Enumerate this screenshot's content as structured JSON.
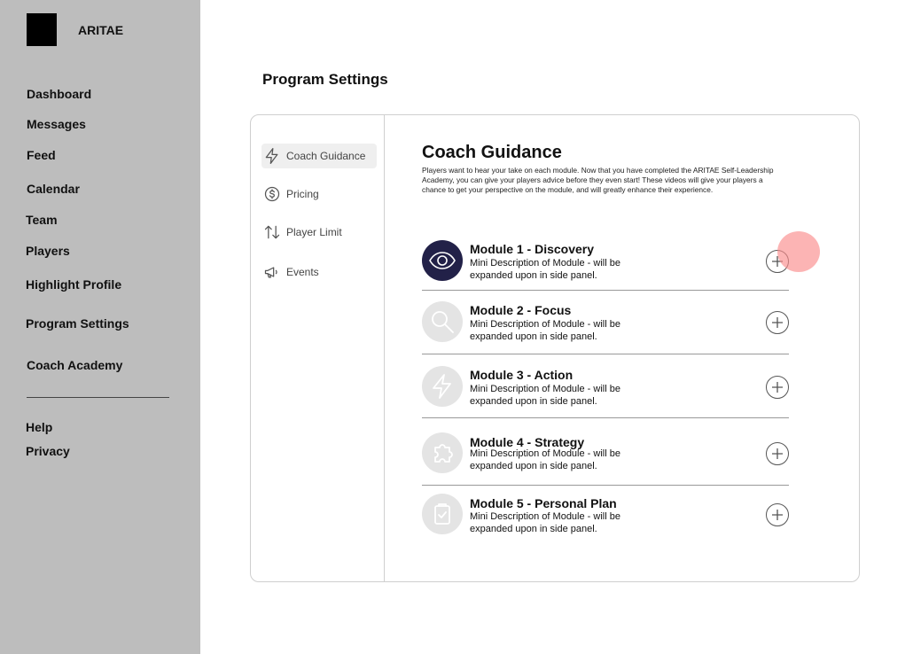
{
  "brand": {
    "name": "ARITAE"
  },
  "sidebar": {
    "items": [
      {
        "id": "dashboard",
        "label": "Dashboard"
      },
      {
        "id": "messages",
        "label": "Messages"
      },
      {
        "id": "feed",
        "label": "Feed"
      },
      {
        "id": "calendar",
        "label": "Calendar"
      },
      {
        "id": "team",
        "label": "Team"
      },
      {
        "id": "players",
        "label": "Players"
      },
      {
        "id": "highlight-profile",
        "label": "Highlight Profile"
      },
      {
        "id": "program-settings",
        "label": "Program Settings"
      },
      {
        "id": "coach-academy",
        "label": "Coach Academy"
      }
    ],
    "footer_items": [
      {
        "id": "help",
        "label": "Help"
      },
      {
        "id": "privacy",
        "label": "Privacy"
      }
    ]
  },
  "page": {
    "title": "Program Settings"
  },
  "settings_tabs": [
    {
      "id": "coach-guidance",
      "label": "Coach Guidance",
      "icon": "lightning-icon",
      "active": true
    },
    {
      "id": "pricing",
      "label": "Pricing",
      "icon": "dollar-icon",
      "active": false
    },
    {
      "id": "player-limit",
      "label": "Player Limit",
      "icon": "sort-arrows-icon",
      "active": false
    },
    {
      "id": "events",
      "label": "Events",
      "icon": "megaphone-icon",
      "active": false
    }
  ],
  "coach_guidance": {
    "title": "Coach Guidance",
    "description": "Players want to hear your take on each module. Now that you have completed the ARITAE Self-Leadership Academy, you can give your players advice before they even start! These videos will give your players a chance to get your perspective on the module, and will greatly enhance their experience.",
    "modules": [
      {
        "title": "Module 1 - Discovery",
        "description": "Mini Description of Module - will be expanded upon in side panel.",
        "icon": "eye-icon",
        "active": true
      },
      {
        "title": "Module 2 - Focus",
        "description": "Mini Description of Module - will be expanded upon in side panel.",
        "icon": "magnifier-icon",
        "active": false
      },
      {
        "title": "Module 3 - Action",
        "description": "Mini Description of Module - will be expanded upon in side panel.",
        "icon": "lightning-icon",
        "active": false
      },
      {
        "title": "Module 4 - Strategy",
        "description": "Mini Description of Module - will be expanded upon in side panel.",
        "icon": "puzzle-icon",
        "active": false
      },
      {
        "title": "Module 5 - Personal Plan",
        "description": "Mini Description of Module - will be expanded upon in side panel.",
        "icon": "clipboard-check-icon",
        "active": false
      }
    ]
  },
  "colors": {
    "sidebar_bg": "#bdbdbd",
    "active_module_icon": "#222148",
    "inactive_module_icon": "#e4e4e4",
    "click_indicator": "#fa8c8c"
  }
}
